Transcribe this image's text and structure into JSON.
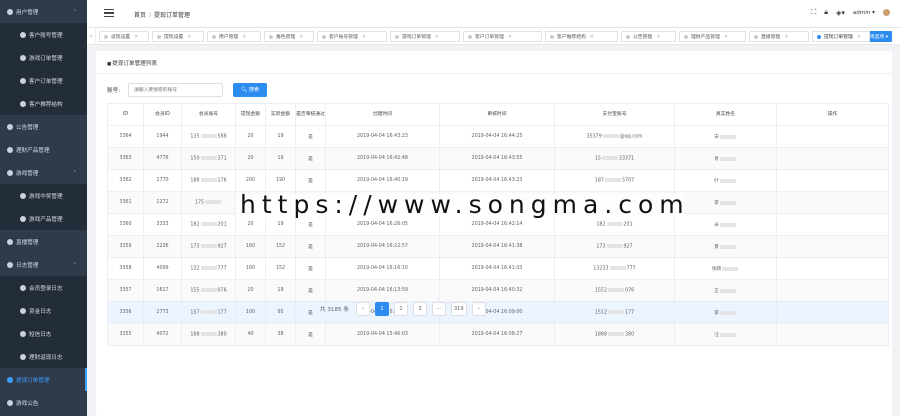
{
  "sidebar": {
    "items": [
      {
        "label": "用户管理",
        "chev": "⌃",
        "sub": false
      },
      {
        "label": "客户账号管理",
        "sub": true
      },
      {
        "label": "游戏订单管理",
        "sub": true
      },
      {
        "label": "客户订单管理",
        "sub": true
      },
      {
        "label": "客户推荐结构",
        "sub": true
      },
      {
        "label": "公告管理",
        "sub": false
      },
      {
        "label": "理财产品管理",
        "sub": false
      },
      {
        "label": "游戏管理",
        "chev": "⌃",
        "sub": false
      },
      {
        "label": "游戏中奖管理",
        "sub": true
      },
      {
        "label": "游戏产品管理",
        "sub": true
      },
      {
        "label": "直播管理",
        "sub": false
      },
      {
        "label": "日志管理",
        "chev": "⌃",
        "sub": false
      },
      {
        "label": "会员登录日志",
        "sub": true
      },
      {
        "label": "资金日志",
        "sub": true
      },
      {
        "label": "短信日志",
        "sub": true
      },
      {
        "label": "理财返现日志",
        "sub": true
      },
      {
        "label": "提现订单管理",
        "sub": false,
        "active": true
      },
      {
        "label": "游戏公告",
        "sub": false
      }
    ]
  },
  "header": {
    "breadcrumb_home": "首页",
    "breadcrumb_sep": "/",
    "breadcrumb_current": "提现订单管理",
    "user": "admin ▾"
  },
  "tabs": {
    "items": [
      "返现设置",
      "提现设置",
      "用户管理",
      "角色管理",
      "客户账号管理",
      "游戏订单管理",
      "客户订单管理",
      "客户推荐结构",
      "公告管理",
      "理财产品管理",
      "直播管理",
      "提现订单管理"
    ],
    "active_index": 11,
    "close_label": "关闭选项 ▾"
  },
  "main": {
    "title": "提现订单管理列表",
    "search_label": "账号:",
    "search_placeholder": "请输入要搜索的账号",
    "search_button": "搜索",
    "columns": [
      "ID",
      "会员ID",
      "会员账号",
      "提现金额",
      "实际金额",
      "是否审核通过",
      "创建时间",
      "审核时间",
      "支付宝账号",
      "真实姓名",
      "操作"
    ],
    "rows": [
      [
        "3364",
        "1944",
        "135",
        "588",
        "20",
        "19",
        "是",
        "2019-04-04 16:43:23",
        "2019-04-04 16:44:25",
        "35379",
        "@qq.com",
        "宋",
        ""
      ],
      [
        "3363",
        "4776",
        "150",
        "371",
        "20",
        "19",
        "是",
        "2019-04-04 16:42:48",
        "2019-04-04 16:43:55",
        "15",
        "33371",
        "肖",
        ""
      ],
      [
        "3362",
        "2770",
        "188",
        "176",
        "200",
        "190",
        "是",
        "2019-04-04 16:40:19",
        "2019-04-04 16:43:23",
        "187",
        "5707",
        "叶",
        ""
      ],
      [
        "3361",
        "1272",
        "175",
        "",
        "",
        "",
        "",
        "",
        "",
        "",
        "",
        "李",
        ""
      ],
      [
        "3360",
        "3333",
        "182",
        "201",
        "20",
        "19",
        "是",
        "2019-04-04 16:26:05",
        "2019-04-04 16:42:14",
        "182",
        "201",
        "米",
        ""
      ],
      [
        "3359",
        "2236",
        "173",
        "927",
        "160",
        "152",
        "是",
        "2019-04-04 16:22:57",
        "2019-04-04 16:41:38",
        "173",
        "927",
        "景",
        ""
      ],
      [
        "3358",
        "4099",
        "132",
        "777",
        "160",
        "152",
        "是",
        "2019-04-04 16:16:10",
        "2019-04-04 16:41:03",
        "13233",
        "777",
        "张晓",
        ""
      ],
      [
        "3357",
        "1617",
        "155",
        "076",
        "20",
        "19",
        "是",
        "2019-04-04 16:13:59",
        "2019-04-04 16:40:32",
        "1552",
        "076",
        "王",
        ""
      ],
      [
        "3356",
        "2773",
        "157",
        "177",
        "100",
        "95",
        "是",
        "2019-04-04 15:48:55",
        "2019-04-04 16:09:00",
        "1512",
        "177",
        "李",
        ""
      ],
      [
        "3355",
        "4072",
        "188",
        "380",
        "40",
        "38",
        "是",
        "2019-04-04 15:46:03",
        "2019-04-04 16:08:27",
        "1888",
        "380",
        "汪",
        ""
      ]
    ]
  },
  "pagination": {
    "total": "共 3185 条",
    "prev": "‹",
    "pages": [
      "1",
      "2",
      "3",
      "···",
      "319"
    ],
    "next": "›"
  },
  "watermark": "https://www.songma.com"
}
